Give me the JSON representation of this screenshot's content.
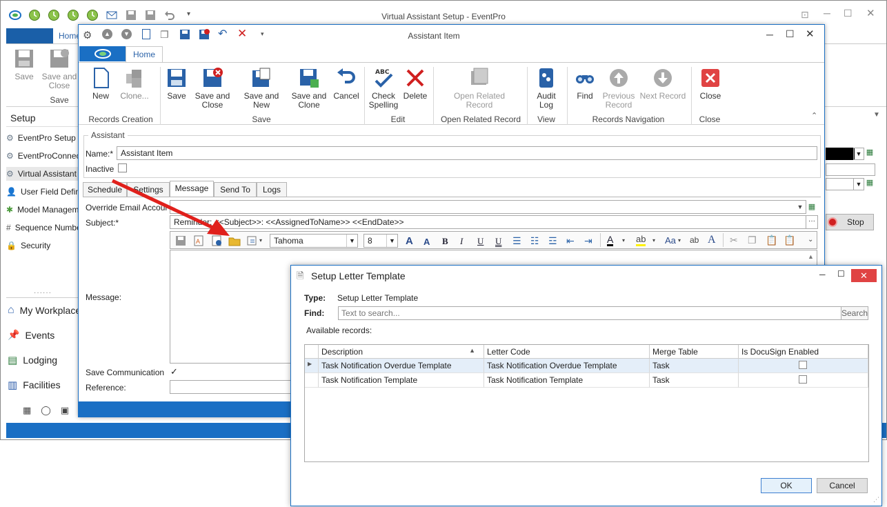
{
  "main": {
    "title": "Virtual Assistant Setup - EventPro",
    "home_tab": "Home",
    "ribbon": {
      "save": "Save",
      "save_close": "Save and Close",
      "group_save": "Save"
    },
    "nav_header": "Setup",
    "nav_items": [
      "EventPro Setup",
      "EventProConnect",
      "Virtual Assistant",
      "User Field Definitions",
      "Model Management",
      "Sequence Numbers",
      "Security"
    ],
    "nav_big": [
      "My Workplace",
      "Events",
      "Lodging",
      "Facilities"
    ],
    "stop_label": "Stop"
  },
  "assistant": {
    "title": "Assistant Item",
    "home_tab": "Home",
    "ribbon": {
      "new": "New",
      "clone": "Clone...",
      "save": "Save",
      "save_close": "Save and Close",
      "save_new": "Save and New",
      "save_clone": "Save and Clone",
      "cancel": "Cancel",
      "check_spelling": "Check Spelling",
      "delete": "Delete",
      "open_related": "Open Related Record",
      "audit_log": "Audit Log",
      "find": "Find",
      "previous": "Previous Record",
      "next": "Next Record",
      "close": "Close",
      "groups": {
        "records_creation": "Records Creation",
        "save": "Save",
        "edit": "Edit",
        "open_related": "Open Related Record",
        "view": "View",
        "navigation": "Records Navigation",
        "close": "Close"
      }
    },
    "section_assistant": "Assistant",
    "name_label": "Name:*",
    "name_value": "Assistant Item",
    "inactive_label": "Inactive",
    "tabs": [
      "Schedule",
      "Settings",
      "Message",
      "Send To",
      "Logs"
    ],
    "override_label": "Override Email Account:",
    "subject_label": "Subject:*",
    "subject_value": "Reminder: <<Subject>>: <<AssignedToName>> <<EndDate>>",
    "font_name": "Tahoma",
    "font_size": "8",
    "message_label": "Message:",
    "save_comm_label": "Save Communication",
    "save_comm_checked": true,
    "reference_label": "Reference:"
  },
  "dialog": {
    "title": "Setup Letter Template",
    "type_label": "Type:",
    "type_value": "Setup Letter Template",
    "find_label": "Find:",
    "find_placeholder": "Text to search...",
    "search_button": "Search",
    "available": "Available records:",
    "columns": [
      "Description",
      "Letter Code",
      "Merge Table",
      "Is DocuSign Enabled"
    ],
    "rows": [
      {
        "description": "Task Notification Overdue Template",
        "letter_code": "Task Notification Overdue Template",
        "merge_table": "Task",
        "docusign": false
      },
      {
        "description": "Task Notification Template",
        "letter_code": "Task Notification Template",
        "merge_table": "Task",
        "docusign": false
      }
    ],
    "ok": "OK",
    "cancel": "Cancel"
  },
  "colors": {
    "accent": "#1a6fc4",
    "arrow": "#e0201b",
    "close_red": "#e04343"
  }
}
